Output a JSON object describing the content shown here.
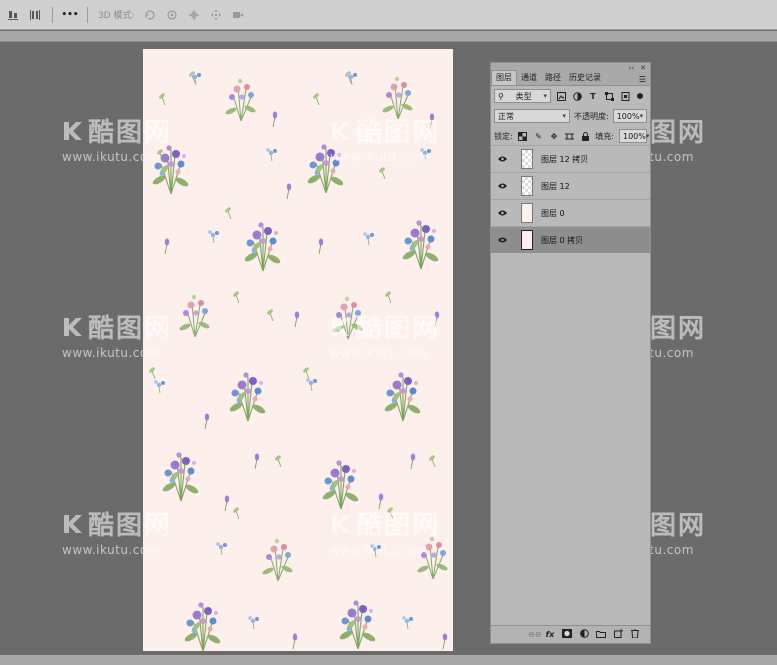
{
  "toolbar": {
    "mode_label": "3D 模式:",
    "icons": [
      "align-bottom-icon",
      "distribute-icon",
      "more-icon",
      "3d-rotate-icon",
      "3d-roll-icon",
      "3d-pan-icon",
      "3d-slide-icon",
      "3d-scale-icon"
    ]
  },
  "panel": {
    "tabs": [
      "图层",
      "通道",
      "路径",
      "历史记录"
    ],
    "active_tab": "图层",
    "filter_kind": "类型",
    "blend_mode": "正常",
    "opacity_label": "不透明度:",
    "opacity_value": "100%",
    "lock_label": "锁定:",
    "fill_label": "填充:",
    "fill_value": "100%",
    "layers": [
      {
        "name": "图层 12 拷贝",
        "visible": true,
        "selected": false
      },
      {
        "name": "图层 12",
        "visible": true,
        "selected": false
      },
      {
        "name": "图层 0",
        "visible": true,
        "selected": false
      },
      {
        "name": "图层 0 拷贝",
        "visible": true,
        "selected": true
      }
    ],
    "footer_icons": [
      "link-icon",
      "fx-icon",
      "mask-icon",
      "adjustment-icon",
      "folder-icon",
      "new-layer-icon",
      "trash-icon"
    ],
    "footer_fx": "fx"
  },
  "watermark": {
    "logo_text": "酷图网",
    "url": "www.ikutu.com"
  },
  "colors": {
    "workspace": "#6b6b6b",
    "canvas": "#fcefec",
    "panel": "#b9b9b9",
    "selected_layer": "#8e8e8e"
  }
}
